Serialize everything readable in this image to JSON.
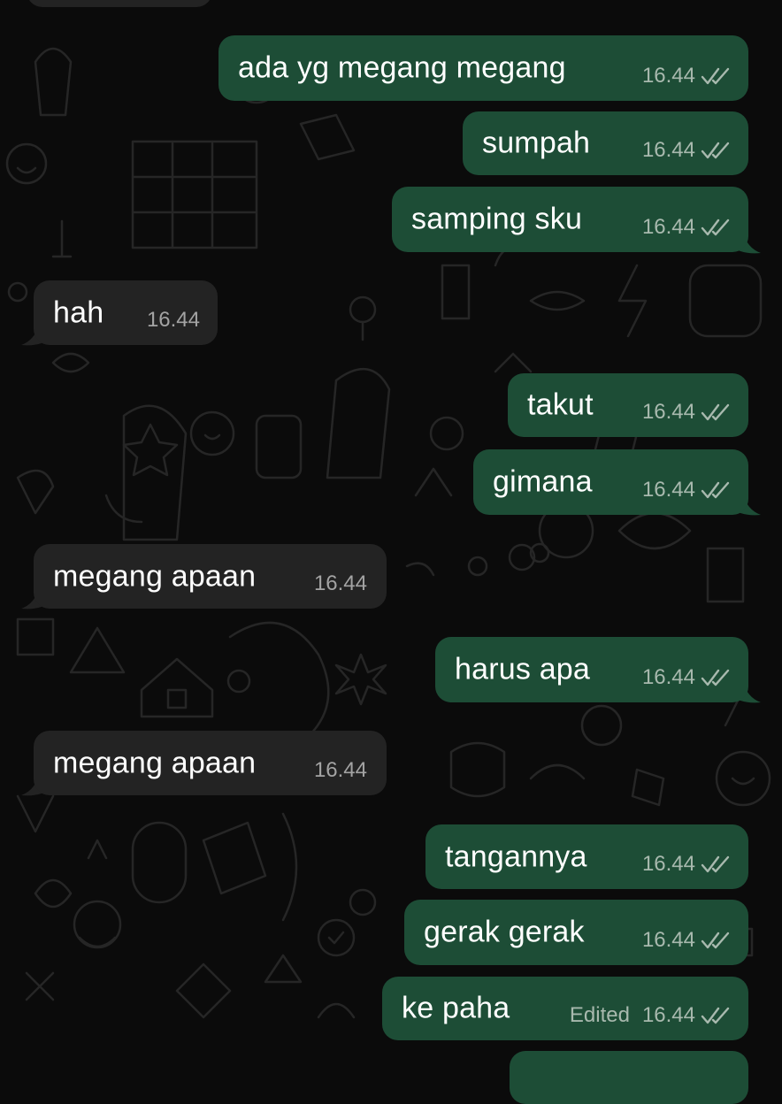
{
  "chat": {
    "messages": [
      {
        "id": "m0",
        "dir": "in",
        "text": "",
        "time": "",
        "edited": "",
        "read": false
      },
      {
        "id": "m1",
        "dir": "out",
        "text": "ada yg megang megang",
        "time": "16.44",
        "edited": "",
        "read": true
      },
      {
        "id": "m2",
        "dir": "out",
        "text": "sumpah",
        "time": "16.44",
        "edited": "",
        "read": true
      },
      {
        "id": "m3",
        "dir": "out",
        "text": "samping sku",
        "time": "16.44",
        "edited": "",
        "read": true
      },
      {
        "id": "m4",
        "dir": "in",
        "text": "hah",
        "time": "16.44",
        "edited": "",
        "read": false
      },
      {
        "id": "m5",
        "dir": "out",
        "text": "takut",
        "time": "16.44",
        "edited": "",
        "read": true
      },
      {
        "id": "m6",
        "dir": "out",
        "text": "gimana",
        "time": "16.44",
        "edited": "",
        "read": true
      },
      {
        "id": "m7",
        "dir": "in",
        "text": "megang apaan",
        "time": "16.44",
        "edited": "",
        "read": false
      },
      {
        "id": "m8",
        "dir": "out",
        "text": "harus apa",
        "time": "16.44",
        "edited": "",
        "read": true
      },
      {
        "id": "m9",
        "dir": "in",
        "text": "megang apaan",
        "time": "16.44",
        "edited": "",
        "read": false
      },
      {
        "id": "m10",
        "dir": "out",
        "text": "tangannya",
        "time": "16.44",
        "edited": "",
        "read": true
      },
      {
        "id": "m11",
        "dir": "out",
        "text": "gerak gerak",
        "time": "16.44",
        "edited": "",
        "read": true
      },
      {
        "id": "m12",
        "dir": "out",
        "text": "ke paha",
        "time": "16.44",
        "edited": "Edited",
        "read": true
      },
      {
        "id": "m13",
        "dir": "out",
        "text": "",
        "time": "",
        "edited": "",
        "read": false
      }
    ]
  },
  "colors": {
    "background": "#0b0b0b",
    "outgoing_bubble": "#1d4d36",
    "incoming_bubble": "#232323",
    "read_ticks": "#a8b9ae"
  },
  "icons": {
    "read_receipt": "double-check-icon",
    "wallpaper": "doodle-pattern"
  }
}
